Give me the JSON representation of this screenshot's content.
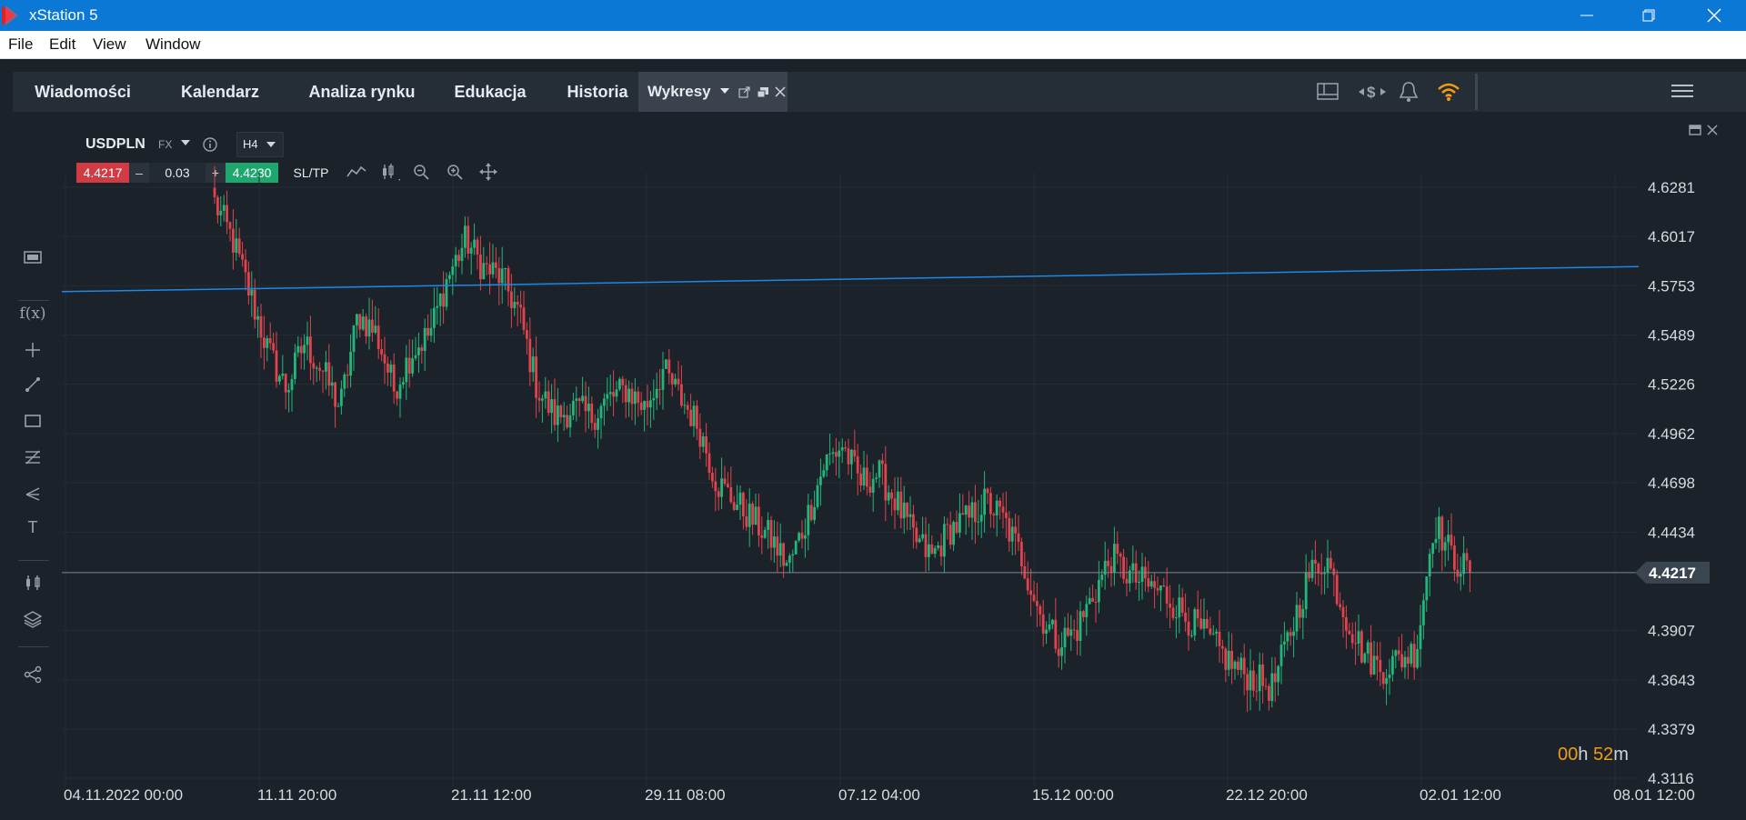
{
  "window": {
    "title": "xStation 5"
  },
  "menu": [
    "File",
    "Edit",
    "View",
    "Window"
  ],
  "nav": {
    "tabs": [
      "Wiadomości",
      "Kalendarz",
      "Analiza rynku",
      "Edukacja",
      "Historia"
    ],
    "active_tab": "Wykresy"
  },
  "instrument": {
    "symbol": "USDPLN",
    "type": "FX",
    "timeframe": "H4",
    "sell_price": "4.4217",
    "volume": "0.03",
    "buy_price": "4.4230",
    "sltp_label": "SL/TP"
  },
  "countdown": {
    "h": "00",
    "h_unit": "h",
    "m": "52",
    "m_unit": "m"
  },
  "colors": {
    "up": "#22b77a",
    "down": "#e0434b",
    "trendline": "#1e88e5",
    "priceline": "#7a8896",
    "accent": "#f39c12"
  },
  "icons": [
    "window-layout-icon",
    "dollar-exchange-icon",
    "bell-icon",
    "wifi-signal-icon",
    "hamburger-menu-icon",
    "info-icon",
    "line-chart-icon",
    "candles-icon",
    "zoom-out-icon",
    "zoom-in-icon",
    "move-icon",
    "rectangle-icon",
    "function-icon",
    "crosshair-icon",
    "trendline-icon",
    "fibonacci-icon",
    "pitchfork-icon",
    "text-icon",
    "indicators-icon",
    "layers-icon",
    "share-icon"
  ],
  "chart_data": {
    "type": "candlestick",
    "symbol": "USDPLN",
    "timeframe": "H4",
    "ylim": [
      4.3116,
      4.6281
    ],
    "y_ticks": [
      "4.6281",
      "4.6017",
      "4.5753",
      "4.5489",
      "4.5226",
      "4.4962",
      "4.4698",
      "4.4434",
      "4.3907",
      "4.3643",
      "4.3379",
      "4.3116"
    ],
    "x_ticks": [
      "04.11.2022 00:00",
      "11.11 20:00",
      "21.11 12:00",
      "29.11 08:00",
      "07.12 04:00",
      "15.12 00:00",
      "22.12 20:00",
      "02.01 12:00",
      "08.01 12:00"
    ],
    "current_price": "4.4217",
    "trendline": {
      "start": 4.5722,
      "end": 4.5856
    },
    "close_path": [
      4.62,
      4.6,
      4.57,
      4.54,
      4.52,
      4.545,
      4.53,
      4.51,
      4.56,
      4.55,
      4.52,
      4.54,
      4.55,
      4.58,
      4.6,
      4.585,
      4.58,
      4.56,
      4.52,
      4.505,
      4.51,
      4.505,
      4.515,
      4.52,
      4.51,
      4.53,
      4.515,
      4.5,
      4.47,
      4.46,
      4.45,
      4.44,
      4.425,
      4.45,
      4.48,
      4.49,
      4.47,
      4.475,
      4.46,
      4.44,
      4.43,
      4.445,
      4.45,
      4.46,
      4.45,
      4.43,
      4.4,
      4.385,
      4.39,
      4.41,
      4.43,
      4.42,
      4.415,
      4.41,
      4.4,
      4.39,
      4.38,
      4.37,
      4.365,
      4.36,
      4.39,
      4.42,
      4.43,
      4.4,
      4.38,
      4.37,
      4.375,
      4.38,
      4.45,
      4.43,
      4.4217
    ]
  }
}
